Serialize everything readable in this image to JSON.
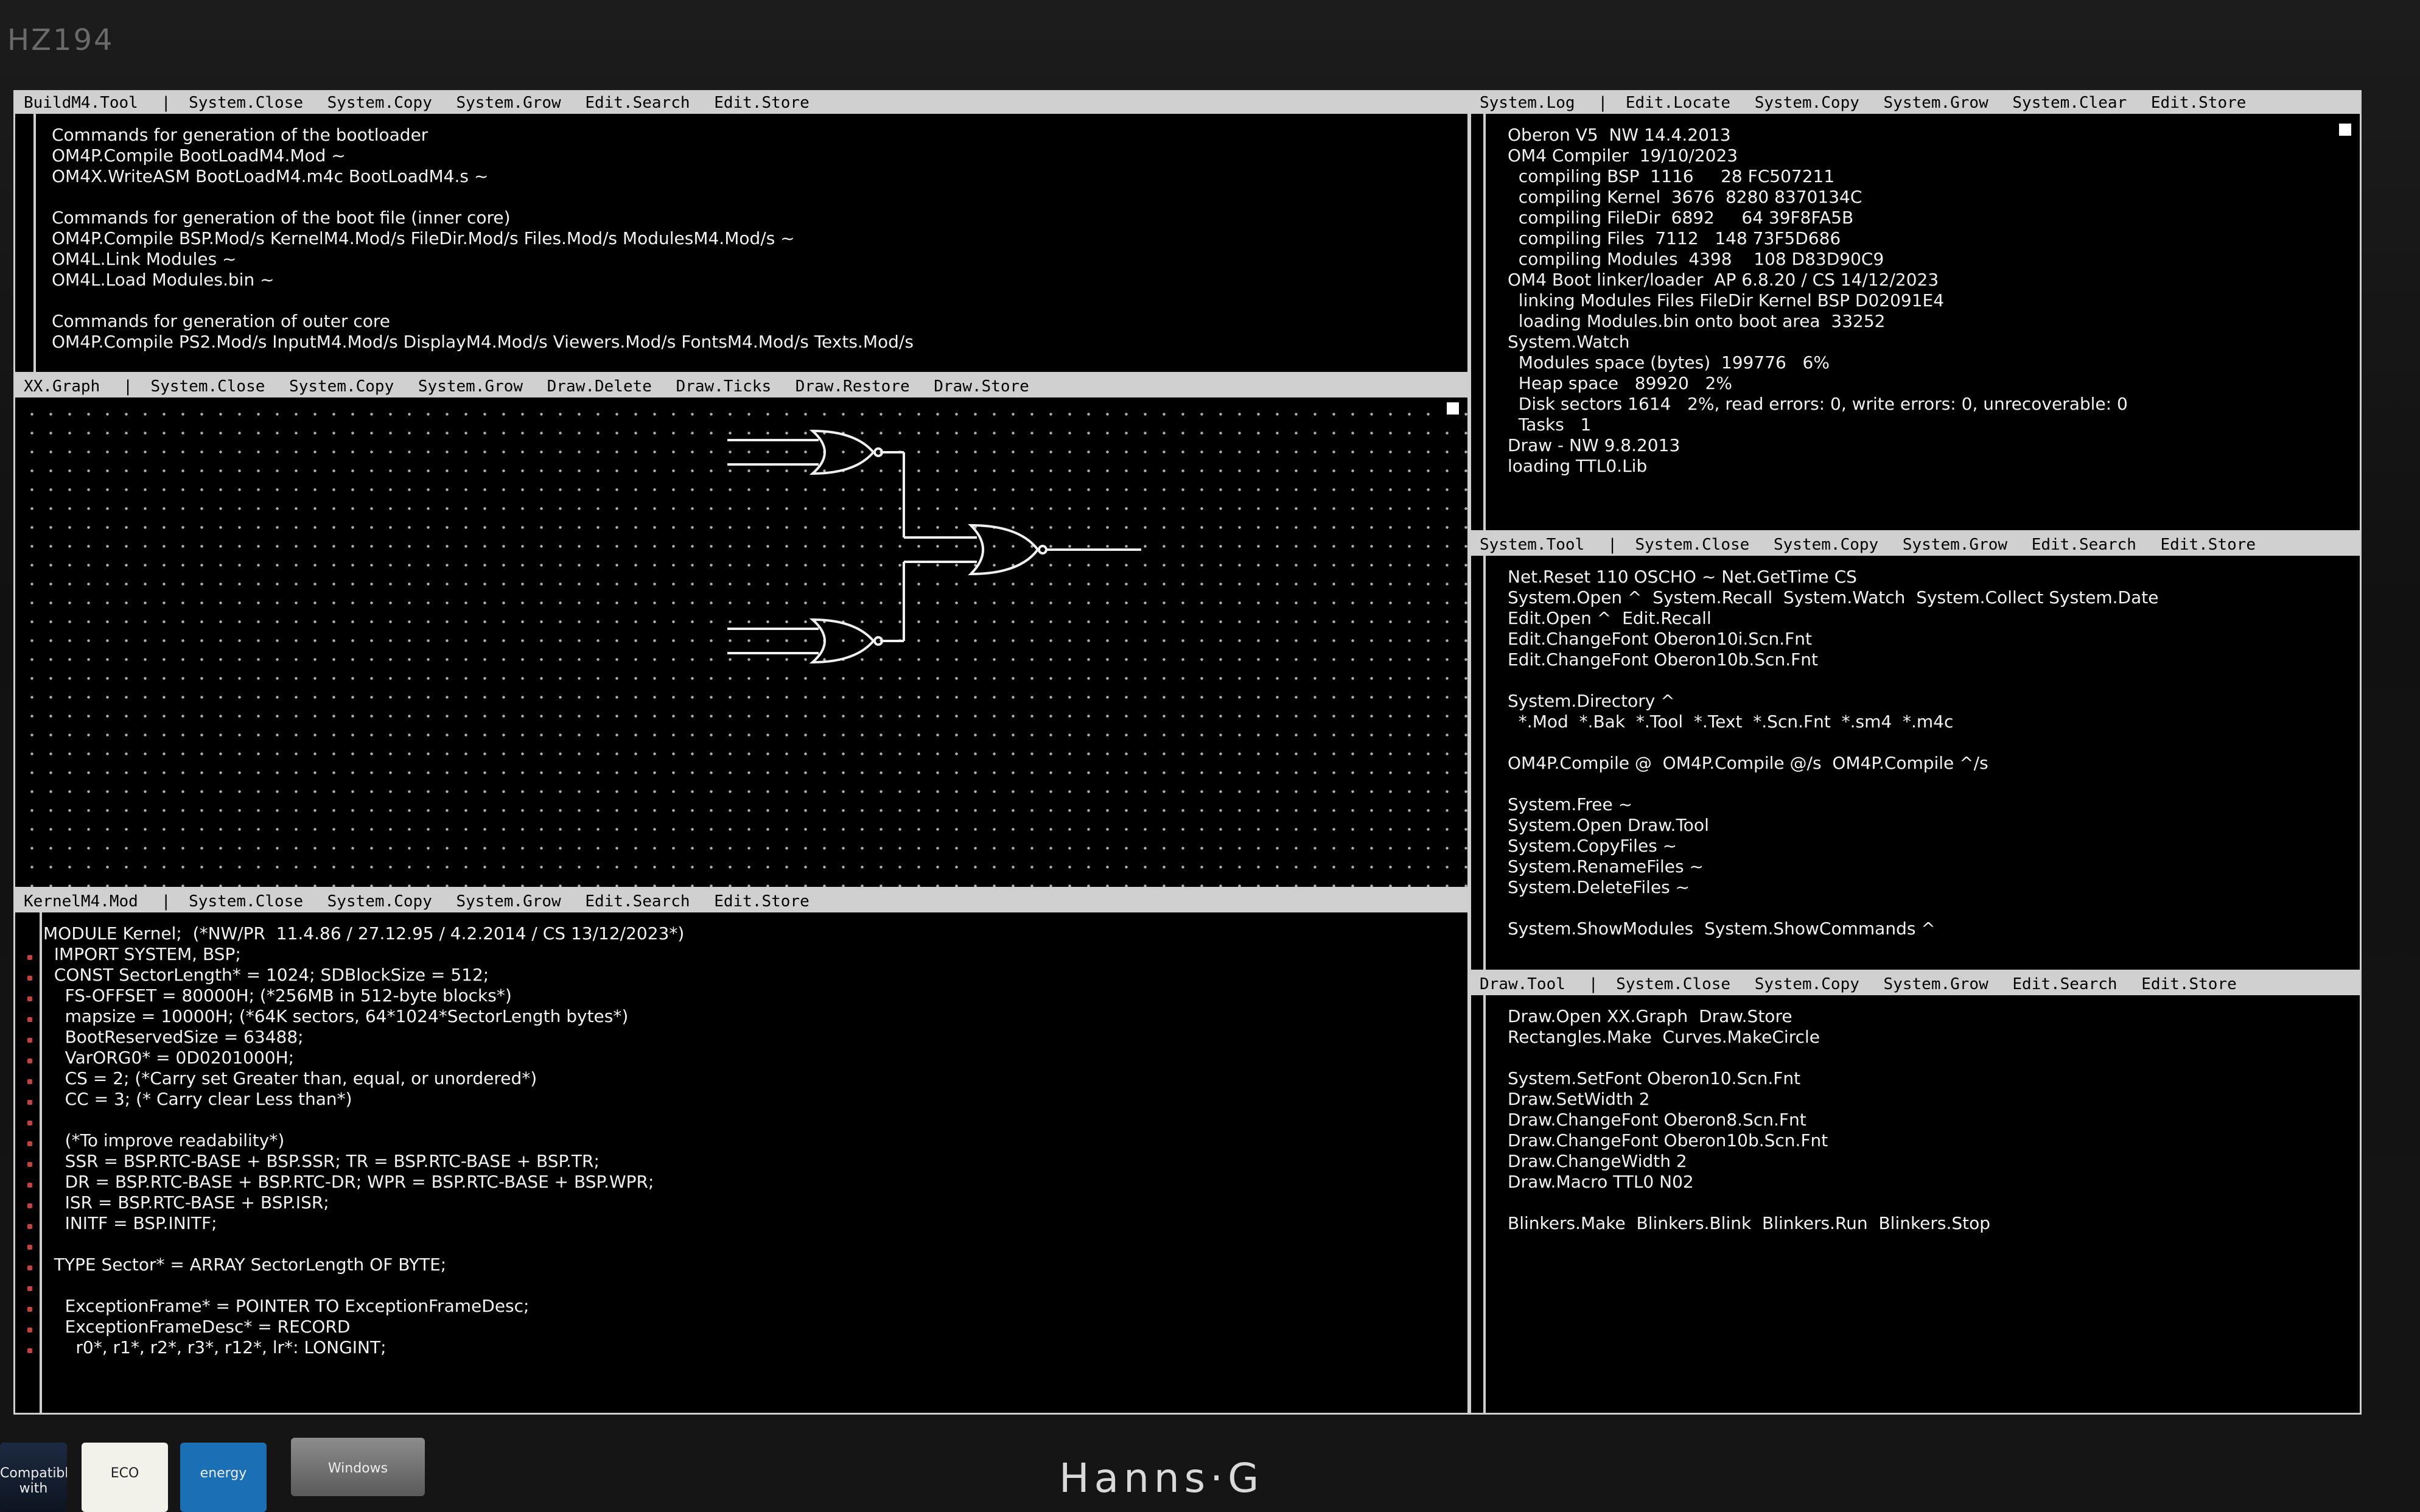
{
  "monitor": {
    "model": "HZ194",
    "brand": "Hanns·G",
    "stickers": [
      "Compatible with",
      "ECO",
      "energy",
      "Windows"
    ]
  },
  "build_viewer": {
    "title": "BuildM4.Tool",
    "commands": [
      "System.Close",
      "System.Copy",
      "System.Grow",
      "Edit.Search",
      "Edit.Store"
    ],
    "lines": [
      "Commands for generation of the bootloader",
      "OM4P.Compile BootLoadM4.Mod ~",
      "OM4X.WriteASM BootLoadM4.m4c BootLoadM4.s ~",
      "",
      "Commands for generation of the boot file (inner core)",
      "OM4P.Compile BSP.Mod/s KernelM4.Mod/s FileDir.Mod/s Files.Mod/s ModulesM4.Mod/s ~",
      "OM4L.Link Modules ~",
      "OM4L.Load Modules.bin ~",
      "",
      "Commands for generation of outer core",
      "OM4P.Compile PS2.Mod/s InputM4.Mod/s DisplayM4.Mod/s Viewers.Mod/s FontsM4.Mod/s Texts.Mod/s"
    ]
  },
  "graph_viewer": {
    "title": "XX.Graph",
    "commands": [
      "System.Close",
      "System.Copy",
      "System.Grow",
      "Draw.Delete",
      "Draw.Ticks",
      "Draw.Restore",
      "Draw.Store"
    ]
  },
  "kernel_viewer": {
    "title": "KernelM4.Mod",
    "commands": [
      "System.Close",
      "System.Copy",
      "System.Grow",
      "Edit.Search",
      "Edit.Store"
    ],
    "lines": [
      "MODULE Kernel;  (*NW/PR  11.4.86 / 27.12.95 / 4.2.2014 / CS 13/12/2023*)",
      "  IMPORT SYSTEM, BSP;",
      "  CONST SectorLength* = 1024; SDBlockSize = 512;",
      "    FS-OFFSET = 80000H; (*256MB in 512-byte blocks*)",
      "    mapsize = 10000H; (*64K sectors, 64*1024*SectorLength bytes*)",
      "    BootReservedSize = 63488;",
      "    VarORG0* = 0D0201000H;",
      "    CS = 2; (*Carry set Greater than, equal, or unordered*)",
      "    CC = 3; (* Carry clear Less than*)",
      "",
      "    (*To improve readability*)",
      "    SSR = BSP.RTC-BASE + BSP.SSR; TR = BSP.RTC-BASE + BSP.TR;",
      "    DR = BSP.RTC-BASE + BSP.RTC-DR; WPR = BSP.RTC-BASE + BSP.WPR;",
      "    ISR = BSP.RTC-BASE + BSP.ISR;",
      "    INITF = BSP.INITF;",
      "",
      "  TYPE Sector* = ARRAY SectorLength OF BYTE;",
      "",
      "    ExceptionFrame* = POINTER TO ExceptionFrameDesc;",
      "    ExceptionFrameDesc* = RECORD",
      "      r0*, r1*, r2*, r3*, r12*, lr*: LONGINT;"
    ]
  },
  "log_viewer": {
    "title": "System.Log",
    "commands": [
      "Edit.Locate",
      "System.Copy",
      "System.Grow",
      "System.Clear",
      "Edit.Store"
    ],
    "lines": [
      "Oberon V5  NW 14.4.2013",
      "OM4 Compiler  19/10/2023",
      "  compiling BSP  1116     28 FC507211",
      "  compiling Kernel  3676  8280 8370134C",
      "  compiling FileDir  6892     64 39F8FA5B",
      "  compiling Files  7112   148 73F5D686",
      "  compiling Modules  4398    108 D83D90C9",
      "OM4 Boot linker/loader  AP 6.8.20 / CS 14/12/2023",
      "  linking Modules Files FileDir Kernel BSP D02091E4",
      "  loading Modules.bin onto boot area  33252",
      "System.Watch",
      "  Modules space (bytes)  199776   6%",
      "  Heap space   89920   2%",
      "  Disk sectors 1614   2%, read errors: 0, write errors: 0, unrecoverable: 0",
      "  Tasks   1",
      "Draw - NW 9.8.2013",
      "loading TTL0.Lib"
    ]
  },
  "system_tool_viewer": {
    "title": "System.Tool",
    "commands": [
      "System.Close",
      "System.Copy",
      "System.Grow",
      "Edit.Search",
      "Edit.Store"
    ],
    "lines": [
      "Net.Reset 110 OSCHO ~ Net.GetTime CS",
      "System.Open ^  System.Recall  System.Watch  System.Collect System.Date",
      "Edit.Open ^  Edit.Recall",
      "Edit.ChangeFont Oberon10i.Scn.Fnt",
      "Edit.ChangeFont Oberon10b.Scn.Fnt",
      "",
      "System.Directory ^",
      "  *.Mod  *.Bak  *.Tool  *.Text  *.Scn.Fnt  *.sm4  *.m4c",
      "",
      "OM4P.Compile @  OM4P.Compile @/s  OM4P.Compile ^/s",
      "",
      "System.Free ~",
      "System.Open Draw.Tool",
      "System.CopyFiles ~",
      "System.RenameFiles ~",
      "System.DeleteFiles ~",
      "",
      "System.ShowModules  System.ShowCommands ^"
    ]
  },
  "draw_tool_viewer": {
    "title": "Draw.Tool",
    "commands": [
      "System.Close",
      "System.Copy",
      "System.Grow",
      "Edit.Search",
      "Edit.Store"
    ],
    "lines": [
      "Draw.Open XX.Graph  Draw.Store",
      "Rectangles.Make  Curves.MakeCircle",
      "",
      "System.SetFont Oberon10.Scn.Fnt",
      "Draw.SetWidth 2",
      "Draw.ChangeFont Oberon8.Scn.Fnt",
      "Draw.ChangeFont Oberon10b.Scn.Fnt",
      "Draw.ChangeWidth 2",
      "Draw.Macro TTL0 N02",
      "",
      "Blinkers.Make  Blinkers.Blink  Blinkers.Run  Blinkers.Stop"
    ]
  }
}
